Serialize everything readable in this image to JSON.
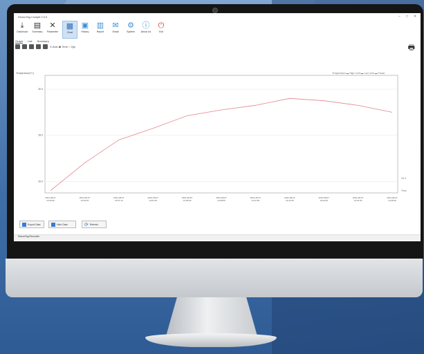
{
  "window": {
    "title": "SensoTag Cockpit 2.0.0"
  },
  "toolbar": {
    "buttons": [
      {
        "label": "Download",
        "icon": "download-icon",
        "glyph": "⤓"
      },
      {
        "label": "Summary",
        "icon": "summary-icon",
        "glyph": "▤"
      },
      {
        "label": "Parameter",
        "icon": "tools-icon",
        "glyph": "✕"
      },
      {
        "label": "Chart",
        "icon": "chart-icon",
        "glyph": "▦"
      },
      {
        "label": "History",
        "icon": "history-icon",
        "glyph": "▣"
      },
      {
        "label": "Report",
        "icon": "report-icon",
        "glyph": "▥"
      },
      {
        "label": "Email",
        "icon": "email-icon",
        "glyph": "✉"
      },
      {
        "label": "System",
        "icon": "settings-icon",
        "glyph": "⚙"
      },
      {
        "label": "About Us",
        "icon": "info-icon",
        "glyph": "ⓘ"
      },
      {
        "label": "Exit",
        "icon": "power-icon",
        "glyph": "⏻"
      }
    ]
  },
  "tabs": [
    "Graph",
    "List",
    "Summary"
  ],
  "zoom": {
    "label": "X-Axis",
    "option1": "Time",
    "option2": "Qty"
  },
  "chart_data": {
    "type": "line",
    "title": "",
    "ylabel": "Temperature(°C)",
    "legend": [
      "Temperature",
      "High Limit",
      "Low Limit",
      "Pause"
    ],
    "x": [
      "2021-08-07 13:49:20",
      "2021-08-07 13:53:15",
      "2021-08-07 13:57:10",
      "2021-08-07 14:01:05",
      "2021-08-07 14:05:00",
      "2021-08-07 14:08:55",
      "2021-08-07 14:12:50",
      "2021-08-07 14:16:45",
      "2021-08-07 14:20:40",
      "2021-08-07 14:24:35",
      "2021-08-07 14:28:30"
    ],
    "ytick_labels": [
      "30.0",
      "28.0",
      "26.0"
    ],
    "right_labels": [
      "26.0",
      "Time"
    ],
    "series": [
      {
        "name": "Temperature",
        "values": [
          25.6,
          26.8,
          27.8,
          28.3,
          28.85,
          29.1,
          29.3,
          29.6,
          29.5,
          29.3,
          29.0
        ]
      }
    ]
  },
  "bottom": {
    "btn1": "Export Data",
    "btn2": "Hide Data",
    "btn3": "Refresh"
  },
  "status": {
    "text": "SensoTag Recorder"
  }
}
